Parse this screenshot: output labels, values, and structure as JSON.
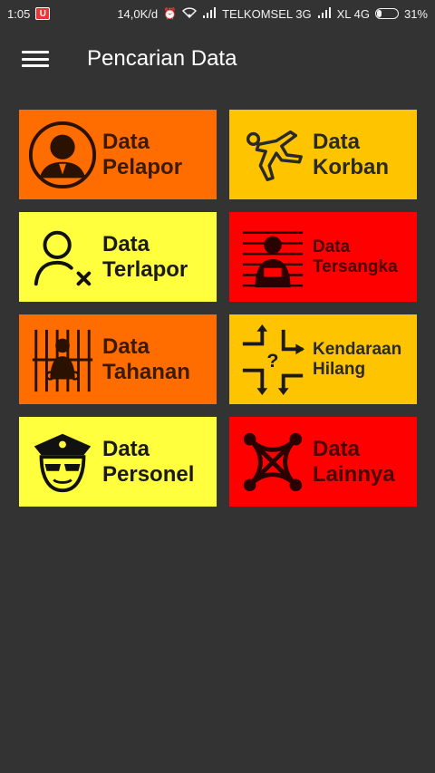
{
  "status_bar": {
    "time": "1:05",
    "notif_badge": "U",
    "net_speed": "14,0K/d",
    "carrier1": "TELKOMSEL 3G",
    "carrier2": "XL 4G",
    "battery": "31%",
    "battery_level": 0.31
  },
  "app_bar": {
    "title": "Pencarian Data"
  },
  "tiles": [
    {
      "line1": "Data",
      "line2": "Pelapor",
      "bg": "#FF6D00",
      "fg": "#3a1a00",
      "icon": "person-avatar-icon"
    },
    {
      "line1": "Data",
      "line2": "Korban",
      "bg": "#FFC400",
      "fg": "#2a2a2a",
      "icon": "crime-outline-icon"
    },
    {
      "line1": "Data",
      "line2": "Terlapor",
      "bg": "#FFFF3D",
      "fg": "#1a1a1a",
      "icon": "user-x-icon"
    },
    {
      "line1": "Data",
      "line2": "Tersangka",
      "bg": "#FF0000",
      "fg": "#4a0000",
      "icon": "suspect-lineup-icon"
    },
    {
      "line1": "Data",
      "line2": "Tahanan",
      "bg": "#FF6D00",
      "fg": "#3a1a00",
      "icon": "prison-bars-icon"
    },
    {
      "line1": "Kendaraan",
      "line2": "Hilang",
      "bg": "#FFC400",
      "fg": "#2a2a2a",
      "icon": "lost-vehicle-icon"
    },
    {
      "line1": "Data",
      "line2": "Personel",
      "bg": "#FFFF3D",
      "fg": "#1a1a1a",
      "icon": "police-officer-icon"
    },
    {
      "line1": "Data",
      "line2": "Lainnya",
      "bg": "#FF0000",
      "fg": "#4a0000",
      "icon": "network-icon"
    }
  ]
}
